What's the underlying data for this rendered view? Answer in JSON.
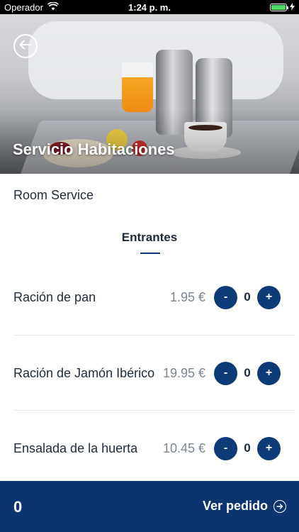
{
  "status_bar": {
    "carrier": "Operador",
    "time": "1:24 p. m.",
    "battery_level": 1.0,
    "battery_color": "#4cd964"
  },
  "hero": {
    "title": "Servicio Habitaciones",
    "back_icon": "arrow-left-circle-icon"
  },
  "subtitle": "Room Service",
  "section": {
    "title": "Entrantes"
  },
  "items": [
    {
      "name": "Ración de pan",
      "price": "1.95 €",
      "quantity": "0",
      "minus_label": "-",
      "plus_label": "+"
    },
    {
      "name": "Ración de Jamón Ibérico",
      "price": "19.95 €",
      "quantity": "0",
      "minus_label": "-",
      "plus_label": "+"
    },
    {
      "name": "Ensalada de la huerta",
      "price": "10.45 €",
      "quantity": "0",
      "minus_label": "-",
      "plus_label": "+"
    }
  ],
  "bottom_bar": {
    "count": "0",
    "view_order_label": "Ver pedido",
    "view_order_icon": "arrow-right-circle-icon"
  },
  "colors": {
    "primary": "#0b3470",
    "button": "#0d3b78",
    "price": "#7a8595",
    "text": "#1f2a3a"
  }
}
